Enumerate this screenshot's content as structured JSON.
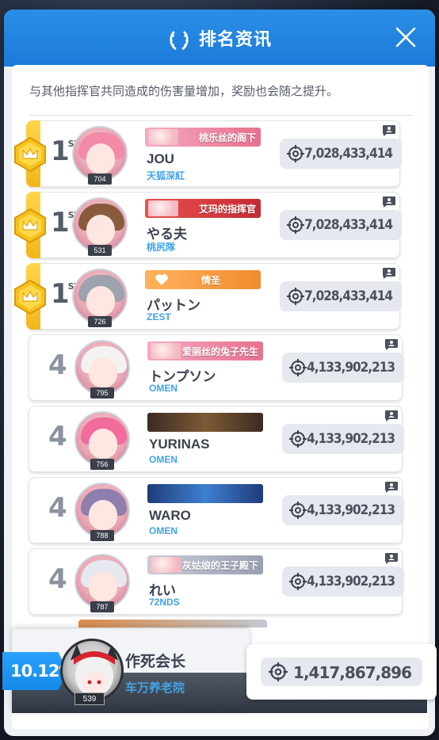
{
  "header": {
    "title": "排名资讯"
  },
  "description": "与其他指挥官共同造成的伤害量增加，奖励也会随之提升。",
  "rows": [
    {
      "rank": "1",
      "suffix": "ST",
      "level": "704",
      "title": "桃乐丝的阁下",
      "name": "JOU",
      "guild": "天狐深紅",
      "score": "7,028,433,414"
    },
    {
      "rank": "1",
      "suffix": "ST",
      "level": "531",
      "title": "艾玛的指挥官",
      "name": "やる夫",
      "guild": "桃尻隊",
      "score": "7,028,433,414"
    },
    {
      "rank": "1",
      "suffix": "ST",
      "level": "726",
      "title": "情圣",
      "name": "パットン",
      "guild": "ZEST",
      "score": "7,028,433,414"
    },
    {
      "rank": "4",
      "suffix": "",
      "level": "795",
      "title": "爱丽丝的兔子先生",
      "name": "トンプソン",
      "guild": "OMEN",
      "score": "4,133,902,213"
    },
    {
      "rank": "4",
      "suffix": "",
      "level": "756",
      "title": "",
      "name": "YURINAS",
      "guild": "OMEN",
      "score": "4,133,902,213"
    },
    {
      "rank": "4",
      "suffix": "",
      "level": "788",
      "title": "",
      "name": "WARO",
      "guild": "OMEN",
      "score": "4,133,902,213"
    },
    {
      "rank": "4",
      "suffix": "",
      "level": "787",
      "title": "灰姑娘的王子殿下",
      "name": "れい",
      "guild": "72NDS",
      "score": "4,133,902,213"
    }
  ],
  "me": {
    "percent": "10.12%",
    "level": "539",
    "name": "作死会长",
    "guild": "车万养老院",
    "score": "1,417,867,896"
  },
  "colors": {
    "accent": "#1c7ad8",
    "guild": "#41a4e6",
    "gold": "#f2b61c"
  }
}
